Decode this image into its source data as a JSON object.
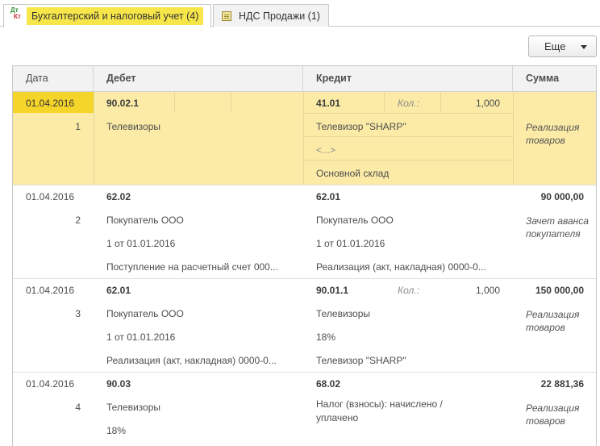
{
  "tabs": [
    {
      "icon": "dt-kt-icon",
      "icon_text_top": "Дт",
      "icon_text_bottom": "Кт",
      "label": "Бухгалтерский и налоговый учет (4)",
      "active": true
    },
    {
      "icon": "document-icon",
      "label": "НДС Продажи (1)",
      "active": false
    }
  ],
  "toolbar": {
    "more_label": "Еще"
  },
  "columns": {
    "date": "Дата",
    "debit": "Дебет",
    "credit": "Кредит",
    "sum": "Сумма"
  },
  "rows": [
    {
      "date": "01.04.2016",
      "num": "1",
      "debit_account": "90.02.1",
      "debit_sub1": "Телевизоры",
      "debit_sub2": "",
      "debit_sub3": "",
      "credit_account": "41.01",
      "qty_label": "Кол.:",
      "qty": "1,000",
      "credit_sub1": "Телевизор \"SHARP\"",
      "credit_sub2": "<...>",
      "credit_sub3": "Основной склад",
      "amount": "",
      "content": "Реализация товаров"
    },
    {
      "date": "01.04.2016",
      "num": "2",
      "debit_account": "62.02",
      "debit_sub1": "Покупатель ООО",
      "debit_sub2": "1 от 01.01.2016",
      "debit_sub3": "Поступление на расчетный счет 000...",
      "credit_account": "62.01",
      "credit_sub1": "Покупатель ООО",
      "credit_sub2": "1 от 01.01.2016",
      "credit_sub3": "Реализация (акт, накладная) 0000-0...",
      "amount": "90 000,00",
      "content": "Зачет аванса покупателя"
    },
    {
      "date": "01.04.2016",
      "num": "3",
      "debit_account": "62.01",
      "debit_sub1": "Покупатель ООО",
      "debit_sub2": "1 от 01.01.2016",
      "debit_sub3": "Реализация (акт, накладная) 0000-0...",
      "credit_account": "90.01.1",
      "qty_label": "Кол.:",
      "qty": "1,000",
      "credit_sub1": "Телевизоры",
      "credit_sub2": "18%",
      "credit_sub3": "Телевизор \"SHARP\"",
      "amount": "150 000,00",
      "content": "Реализация товаров"
    },
    {
      "date": "01.04.2016",
      "num": "4",
      "debit_account": "90.03",
      "debit_sub1": "Телевизоры",
      "debit_sub2": "18%",
      "credit_account": "68.02",
      "credit_sub1": "Налог (взносы): начислено / уплачено",
      "amount": "22 881,36",
      "content": "Реализация товаров"
    }
  ],
  "colors": {
    "selected_row": "#fbeba7",
    "selected_date": "#f6d52b",
    "tab_highlight": "#f7e64a"
  }
}
